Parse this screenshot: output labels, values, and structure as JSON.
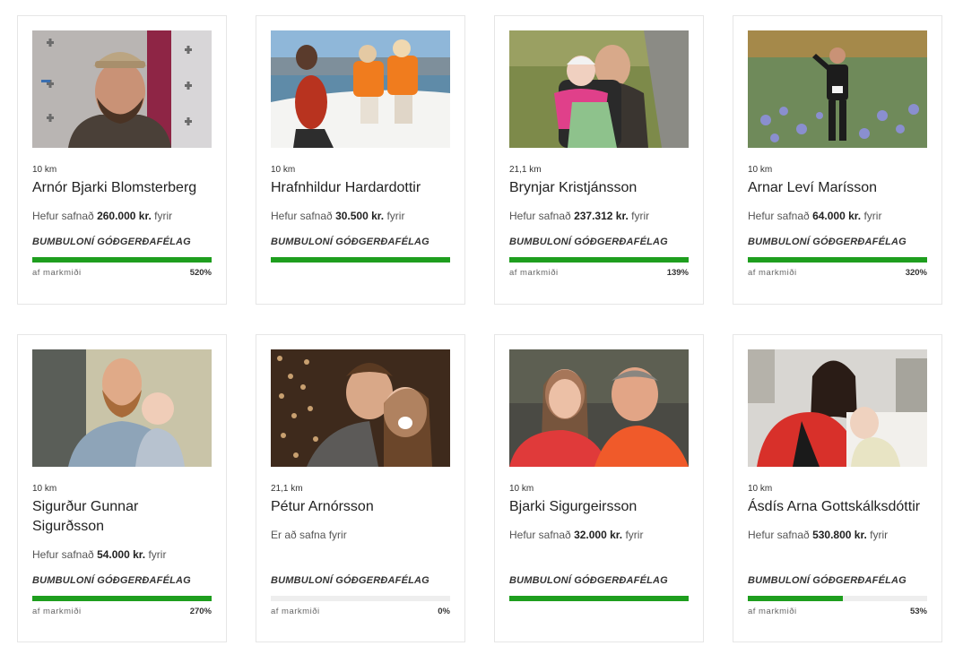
{
  "runners": [
    {
      "distance": "10 km",
      "name": "Arnór Bjarki Blomsterberg",
      "raised_prefix": "Hefur safnað",
      "amount": "260.000 kr.",
      "raised_suffix": "fyrir",
      "charity": "BUMBULONÍ GÓÐGERÐAFÉLAG",
      "progress": 1.0,
      "goal_label": "af markmiði",
      "percent_text": "520%",
      "photo": "man-with-cap-photo"
    },
    {
      "distance": "10 km",
      "name": "Hrafnhildur Hardardottir",
      "raised_prefix": "Hefur safnað",
      "amount": "30.500 kr.",
      "raised_suffix": "fyrir",
      "charity": "BUMBULONÍ GÓÐGERÐAFÉLAG",
      "progress": 1.0,
      "goal_label": "",
      "percent_text": "",
      "photo": "boat-children-photo"
    },
    {
      "distance": "21,1 km",
      "name": "Brynjar Kristjánsson",
      "raised_prefix": "Hefur safnað",
      "amount": "237.312 kr.",
      "raised_suffix": "fyrir",
      "charity": "BUMBULONÍ GÓÐGERÐAFÉLAG",
      "progress": 1.0,
      "goal_label": "af markmiði",
      "percent_text": "139%",
      "photo": "father-child-wheelchair-photo"
    },
    {
      "distance": "10 km",
      "name": "Arnar Leví Marísson",
      "raised_prefix": "Hefur safnað",
      "amount": "64.000 kr.",
      "raised_suffix": "fyrir",
      "charity": "BUMBULONÍ GÓÐGERÐAFÉLAG",
      "progress": 1.0,
      "goal_label": "af markmiði",
      "percent_text": "320%",
      "photo": "runner-lupine-field-photo"
    },
    {
      "distance": "10 km",
      "name": "Sigurður Gunnar Sigurðsson",
      "raised_prefix": "Hefur safnað",
      "amount": "54.000 kr.",
      "raised_suffix": "fyrir",
      "charity": "BUMBULONÍ GÓÐGERÐAFÉLAG",
      "progress": 1.0,
      "goal_label": "af markmiði",
      "percent_text": "270%",
      "photo": "bearded-man-baby-photo"
    },
    {
      "distance": "21,1 km",
      "name": "Pétur Arnórsson",
      "raised_prefix": "Er að safna fyrir",
      "amount": "",
      "raised_suffix": "",
      "charity": "BUMBULONÍ GÓÐGERÐAFÉLAG",
      "progress": 0.0,
      "goal_label": "af markmiði",
      "percent_text": "0%",
      "photo": "couple-selfie-photo"
    },
    {
      "distance": "10 km",
      "name": "Bjarki Sigurgeirsson",
      "raised_prefix": "Hefur safnað",
      "amount": "32.000 kr.",
      "raised_suffix": "fyrir",
      "charity": "BUMBULONÍ GÓÐGERÐAFÉLAG",
      "progress": 1.0,
      "goal_label": "",
      "percent_text": "",
      "photo": "father-daughter-selfie-photo"
    },
    {
      "distance": "10 km",
      "name": "Ásdís Arna Gottskálksdóttir",
      "raised_prefix": "Hefur safnað",
      "amount": "530.800 kr.",
      "raised_suffix": "fyrir",
      "charity": "BUMBULONÍ GÓÐGERÐAFÉLAG",
      "progress": 0.53,
      "goal_label": "af markmiði",
      "percent_text": "53%",
      "photo": "mother-child-hospital-photo"
    }
  ],
  "colors": {
    "progress_fill": "#1e9e1e",
    "progress_track": "#eeeeee"
  }
}
